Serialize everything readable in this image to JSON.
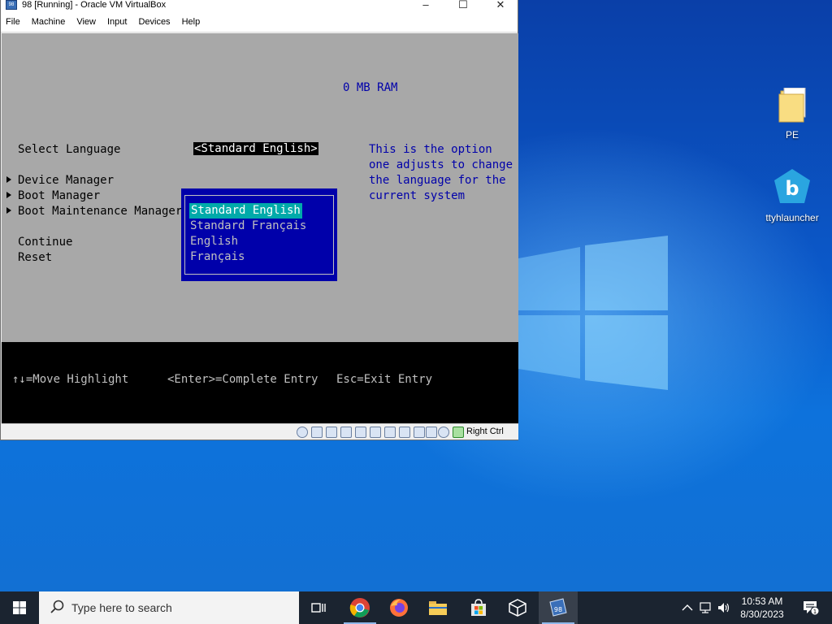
{
  "window": {
    "title": "98 [Running] - Oracle VM VirtualBox",
    "icon_label": "98",
    "controls": [
      "minimize-icon",
      "maximize-icon",
      "close-icon"
    ]
  },
  "menu": [
    "File",
    "Machine",
    "View",
    "Input",
    "Devices",
    "Help"
  ],
  "bios": {
    "ram": "0 MB RAM",
    "select_language_label": "Select Language",
    "selected_language": "<Standard English>",
    "items": [
      "Device Manager",
      "Boot Manager",
      "Boot Maintenance Manager"
    ],
    "continue": "Continue",
    "reset": "Reset",
    "help_lines": [
      "This is the option",
      "one adjusts to change",
      "the language for the",
      "current system"
    ],
    "popup_options": [
      "Standard English",
      "Standard Français",
      "English",
      "Français"
    ],
    "popup_active": 0,
    "footer": {
      "move": "↑↓=Move Highlight",
      "enter": "<Enter>=Complete Entry",
      "esc": "Esc=Exit Entry"
    }
  },
  "statusbar": {
    "host_key": "Right Ctrl",
    "icons": [
      "hard-disk-icon",
      "optical-drive-icon",
      "audio-icon",
      "network-icon",
      "usb-icon",
      "shared-folders-icon",
      "display-icon",
      "video-capture-icon",
      "recording-icon",
      "cpu-icon",
      "mouse-integration-icon",
      "keyboard-capture-icon"
    ]
  },
  "desktop_icons": [
    {
      "label": "PE",
      "icon": "folder-icon"
    },
    {
      "label": "ttyhlauncher",
      "icon": "ttyhlauncher-icon"
    }
  ],
  "taskbar": {
    "search_placeholder": "Type here to search",
    "apps": [
      "task-view-icon",
      "chrome-icon",
      "firefox-icon",
      "file-explorer-icon",
      "microsoft-store-icon",
      "virtualbox-icon",
      "vm-98-icon"
    ],
    "active_app": "vm-98-icon",
    "active_app_label": "98",
    "time": "10:53 AM",
    "date": "8/30/2023",
    "notification_count": "1"
  }
}
